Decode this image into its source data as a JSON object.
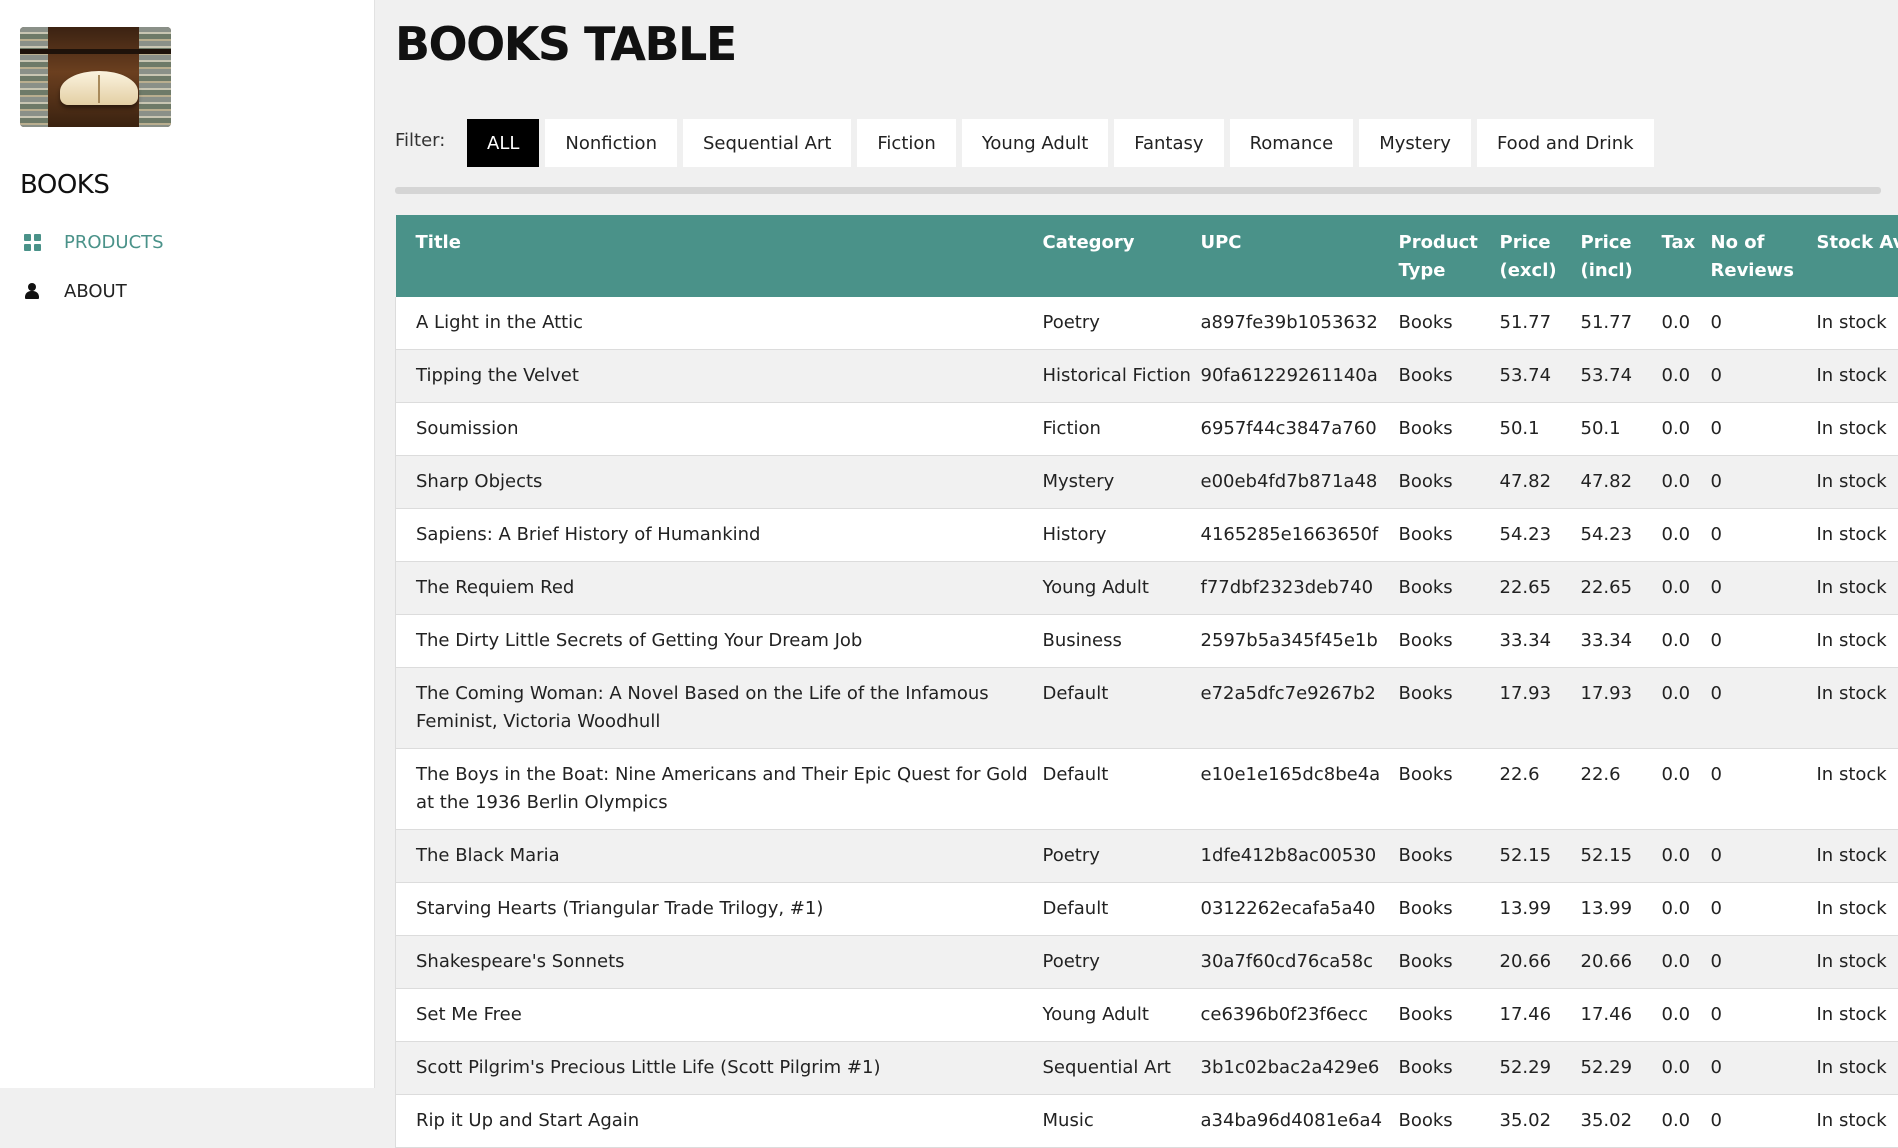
{
  "sidebar": {
    "brand": "BOOKS",
    "nav": [
      {
        "label": "PRODUCTS",
        "icon": "grid-icon",
        "active": true
      },
      {
        "label": "ABOUT",
        "icon": "user-icon",
        "active": false
      }
    ]
  },
  "main": {
    "title": "BOOKS TABLE",
    "filter_label": "Filter:",
    "filters": [
      "ALL",
      "Nonfiction",
      "Sequential Art",
      "Fiction",
      "Young Adult",
      "Fantasy",
      "Romance",
      "Mystery",
      "Food and Drink"
    ],
    "active_filter": "ALL"
  },
  "table": {
    "headers": [
      "Title",
      "Category",
      "UPC",
      "Product Type",
      "Price (excl)",
      "Price (incl)",
      "Tax",
      "No of Reviews",
      "Stock Availability"
    ],
    "rows": [
      [
        "A Light in the Attic",
        "Poetry",
        "a897fe39b1053632",
        "Books",
        "51.77",
        "51.77",
        "0.0",
        "0",
        "In stock"
      ],
      [
        "Tipping the Velvet",
        "Historical Fiction",
        "90fa61229261140a",
        "Books",
        "53.74",
        "53.74",
        "0.0",
        "0",
        "In stock"
      ],
      [
        "Soumission",
        "Fiction",
        "6957f44c3847a760",
        "Books",
        "50.1",
        "50.1",
        "0.0",
        "0",
        "In stock"
      ],
      [
        "Sharp Objects",
        "Mystery",
        "e00eb4fd7b871a48",
        "Books",
        "47.82",
        "47.82",
        "0.0",
        "0",
        "In stock"
      ],
      [
        "Sapiens: A Brief History of Humankind",
        "History",
        "4165285e1663650f",
        "Books",
        "54.23",
        "54.23",
        "0.0",
        "0",
        "In stock"
      ],
      [
        "The Requiem Red",
        "Young Adult",
        "f77dbf2323deb740",
        "Books",
        "22.65",
        "22.65",
        "0.0",
        "0",
        "In stock"
      ],
      [
        "The Dirty Little Secrets of Getting Your Dream Job",
        "Business",
        "2597b5a345f45e1b",
        "Books",
        "33.34",
        "33.34",
        "0.0",
        "0",
        "In stock"
      ],
      [
        "The Coming Woman: A Novel Based on the Life of the Infamous Feminist, Victoria Woodhull",
        "Default",
        "e72a5dfc7e9267b2",
        "Books",
        "17.93",
        "17.93",
        "0.0",
        "0",
        "In stock"
      ],
      [
        "The Boys in the Boat: Nine Americans and Their Epic Quest for Gold at the 1936 Berlin Olympics",
        "Default",
        "e10e1e165dc8be4a",
        "Books",
        "22.6",
        "22.6",
        "0.0",
        "0",
        "In stock"
      ],
      [
        "The Black Maria",
        "Poetry",
        "1dfe412b8ac00530",
        "Books",
        "52.15",
        "52.15",
        "0.0",
        "0",
        "In stock"
      ],
      [
        "Starving Hearts (Triangular Trade Trilogy, #1)",
        "Default",
        "0312262ecafa5a40",
        "Books",
        "13.99",
        "13.99",
        "0.0",
        "0",
        "In stock"
      ],
      [
        "Shakespeare's Sonnets",
        "Poetry",
        "30a7f60cd76ca58c",
        "Books",
        "20.66",
        "20.66",
        "0.0",
        "0",
        "In stock"
      ],
      [
        "Set Me Free",
        "Young Adult",
        "ce6396b0f23f6ecc",
        "Books",
        "17.46",
        "17.46",
        "0.0",
        "0",
        "In stock"
      ],
      [
        "Scott Pilgrim's Precious Little Life (Scott Pilgrim #1)",
        "Sequential Art",
        "3b1c02bac2a429e6",
        "Books",
        "52.29",
        "52.29",
        "0.0",
        "0",
        "In stock"
      ],
      [
        "Rip it Up and Start Again",
        "Music",
        "a34ba96d4081e6a4",
        "Books",
        "35.02",
        "35.02",
        "0.0",
        "0",
        "In stock"
      ]
    ]
  },
  "colors": {
    "accent": "#4a9289",
    "background": "#f0f0f0",
    "active_filter_bg": "#000000"
  }
}
